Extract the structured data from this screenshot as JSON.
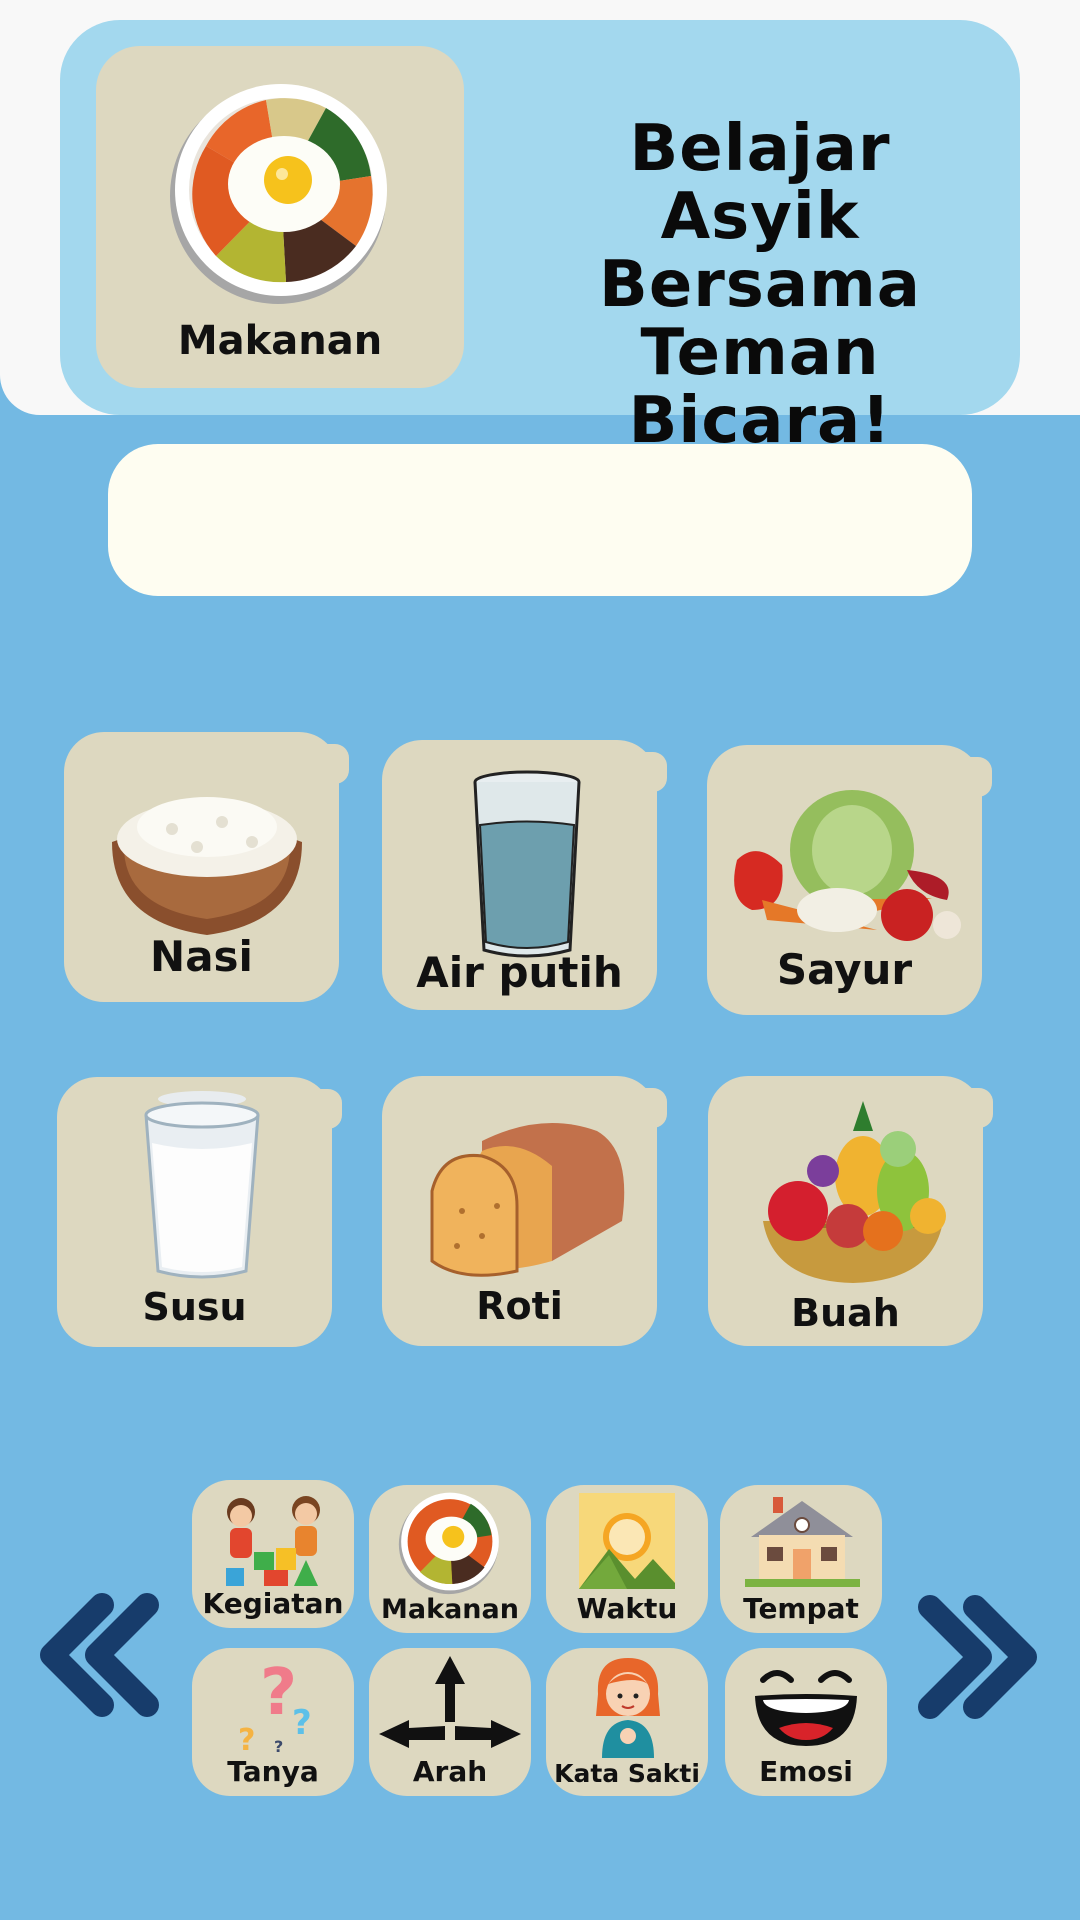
{
  "header": {
    "current_category": "Makanan",
    "title_lines": [
      "Belajar Asyik",
      "Bersama",
      "Teman Bicara!"
    ]
  },
  "sentence_bar": {
    "text": ""
  },
  "items": [
    {
      "label": "Nasi",
      "icon": "rice-bowl-icon"
    },
    {
      "label": "Air putih",
      "icon": "water-glass-icon"
    },
    {
      "label": "Sayur",
      "icon": "vegetables-icon"
    },
    {
      "label": "Susu",
      "icon": "milk-glass-icon"
    },
    {
      "label": "Roti",
      "icon": "bread-icon"
    },
    {
      "label": "Buah",
      "icon": "fruit-basket-icon"
    }
  ],
  "categories": [
    {
      "label": "Kegiatan",
      "icon": "kids-playing-icon"
    },
    {
      "label": "Makanan",
      "icon": "food-bowl-icon"
    },
    {
      "label": "Waktu",
      "icon": "sun-mountain-icon"
    },
    {
      "label": "Tempat",
      "icon": "house-icon"
    },
    {
      "label": "Tanya",
      "icon": "question-marks-icon"
    },
    {
      "label": "Arah",
      "icon": "direction-arrows-icon"
    },
    {
      "label": "Kata Sakti",
      "icon": "girl-icon"
    },
    {
      "label": "Emosi",
      "icon": "laughing-face-icon"
    }
  ],
  "nav": {
    "prev_icon": "double-chevron-left-icon",
    "next_icon": "double-chevron-right-icon"
  },
  "colors": {
    "background": "#73b9e3",
    "header": "#a3d8ee",
    "tile": "#ddd8c0",
    "sentence_bar": "#fefdf1",
    "arrow": "#173c6b"
  }
}
